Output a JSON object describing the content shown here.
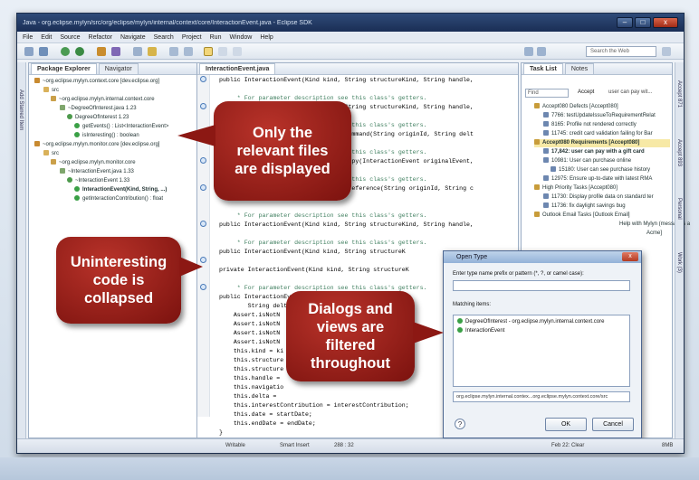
{
  "window": {
    "title": "Java - org.eclipse.mylyn/src/org/eclipse/mylyn/internal/context/core/InteractionEvent.java - Eclipse SDK",
    "controls": [
      "–",
      "□",
      "x"
    ]
  },
  "menu": [
    "File",
    "Edit",
    "Source",
    "Refactor",
    "Navigate",
    "Search",
    "Project",
    "Run",
    "Window",
    "Help"
  ],
  "toolbar": {
    "search_placeholder": "Search the Web"
  },
  "colors": {
    "accent": "#1a2e55",
    "callout": "#a0211a",
    "task_highlight": "#f7e9a6"
  },
  "package_explorer": {
    "tabs": [
      "Package Explorer",
      "Navigator"
    ],
    "items": [
      "~org.eclipse.mylyn.context.core  [dev.eclipse.org]",
      "src",
      "~org.eclipse.mylyn.internal.context.core",
      "~DegreeOfInterest.java 1.23",
      "DegreeOfInterest 1.23",
      "getEvents() : List<InteractionEvent>",
      "isInteresting() : boolean",
      "~org.eclipse.mylyn.monitor.core  [dev.eclipse.org]",
      "src",
      "~org.eclipse.mylyn.monitor.core",
      "~InteractionEvent.java 1.33",
      "~InteractionEvent 1.33",
      "InteractionEvent(Kind, String, ...)",
      "getInteractionContribution() : float"
    ]
  },
  "side_strip_label": "Add Starred Item",
  "editor": {
    "tab": "InteractionEvent.java",
    "lines": [
      "public InteractionEvent(Kind kind, String structureKind, String handle,",
      "     * For parameter description see this class's getters.",
      "public InteractionEvent(Kind kind, String structureKind, String handle,",
      "     * For parameter description see this class's getters.",
      "public static InteractionEvent makeCommand(String originId, String delt",
      "     * For parameter description see this class's getters.",
      "public static InteractionEvent makeCopy(InteractionEvent originalEvent,",
      "     * For parameter description see this class's getters.",
      "public static InteractionEvent makePreference(String originId, String c",
      "     * For parameter description see this class's getters.",
      "public InteractionEvent(Kind kind, String structureKind, String handle,",
      "     * For parameter description see this class's getters.",
      "public InteractionEvent(Kind kind, String structureK",
      "private InteractionEvent(Kind kind, String structureK",
      "     * For parameter description see this class's getters.",
      "public InteractionEvent(Kind kind, String structureK",
      "        String delt",
      "    Assert.isNotN",
      "    Assert.isNotN",
      "    Assert.isNotN",
      "    Assert.isNotN",
      "    this.kind = ki",
      "    this.structure",
      "    this.structure",
      "    this.handle =",
      "    this.navigatio",
      "    this.delta =",
      "    this.interestContribution = interestContribution;",
      "    this.date = startDate;",
      "    this.endDate = endDate;",
      "}"
    ]
  },
  "task_list": {
    "tabs": [
      "Task List",
      "Notes"
    ],
    "find_placeholder": "Find",
    "filter_label": "Accept",
    "filter_hint": "user can pay wit...",
    "items": [
      "Accept080 Defects  [Accept080]",
      "7766: testUpdateIssueToRequirementRelat",
      "8165: Profile not rendered correctly",
      "11745: credit card validation failing for Bar",
      "Accept080 Requirements  [Accept080]",
      "17,842: user can pay with a gift card",
      "10981: User can purchase online",
      "15180: User can see purchase history",
      "12975: Ensure up-to-date with latest RMA",
      "High Priority Tasks  [Accept080]",
      "11730: Display profile data on standard ter",
      "11736: fix daylight savings bug",
      "Outlook Email Tasks  [Outlook Email]",
      "Help with Mylyn (messages a",
      "Acme]"
    ],
    "right_strip": [
      "Accept 871",
      "Accept 893",
      "Personal",
      "Work (3)"
    ]
  },
  "dialog": {
    "title": "Open Type",
    "prompt": "Enter type name prefix or pattern (*, ?, or camel case):",
    "matching_label": "Matching items:",
    "items": [
      "DegreeOfInterest - org.eclipse.mylyn.internal.context.core",
      "InteractionEvent"
    ],
    "path": "org.eclipse.mylyn.internal.contex...org.eclipse.mylyn.context.core/src",
    "ok": "OK",
    "cancel": "Cancel",
    "help": "?"
  },
  "status": {
    "writable": "Writable",
    "insert_mode": "Smart Insert",
    "position": "288 : 32",
    "date": "Feb 22: Clear",
    "memory": "8MB"
  },
  "callouts": [
    "Only the\nrelevant files\nare displayed",
    "Uninteresting\ncode is\ncollapsed",
    "Dialogs and\nviews are\nfiltered\nthroughout"
  ]
}
